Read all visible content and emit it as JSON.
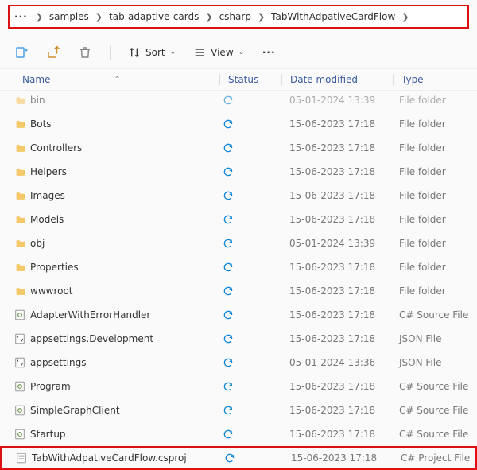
{
  "breadcrumb": {
    "items": [
      "samples",
      "tab-adaptive-cards",
      "csharp",
      "TabWithAdpativeCardFlow"
    ]
  },
  "toolbar": {
    "sort_label": "Sort",
    "view_label": "View"
  },
  "columns": {
    "name": "Name",
    "status": "Status",
    "date": "Date modified",
    "type": "Type"
  },
  "rows": [
    {
      "name": "bin",
      "icon": "folder",
      "date": "05-01-2024 13:39",
      "type": "File folder",
      "faded": true
    },
    {
      "name": "Bots",
      "icon": "folder",
      "date": "15-06-2023 17:18",
      "type": "File folder"
    },
    {
      "name": "Controllers",
      "icon": "folder",
      "date": "15-06-2023 17:18",
      "type": "File folder"
    },
    {
      "name": "Helpers",
      "icon": "folder",
      "date": "15-06-2023 17:18",
      "type": "File folder"
    },
    {
      "name": "Images",
      "icon": "folder",
      "date": "15-06-2023 17:18",
      "type": "File folder"
    },
    {
      "name": "Models",
      "icon": "folder",
      "date": "15-06-2023 17:18",
      "type": "File folder"
    },
    {
      "name": "obj",
      "icon": "folder",
      "date": "05-01-2024 13:39",
      "type": "File folder"
    },
    {
      "name": "Properties",
      "icon": "folder",
      "date": "15-06-2023 17:18",
      "type": "File folder"
    },
    {
      "name": "wwwroot",
      "icon": "folder",
      "date": "15-06-2023 17:18",
      "type": "File folder"
    },
    {
      "name": "AdapterWithErrorHandler",
      "icon": "cs",
      "date": "15-06-2023 17:18",
      "type": "C# Source File"
    },
    {
      "name": "appsettings.Development",
      "icon": "json",
      "date": "15-06-2023 17:18",
      "type": "JSON File"
    },
    {
      "name": "appsettings",
      "icon": "json",
      "date": "05-01-2024 13:36",
      "type": "JSON File"
    },
    {
      "name": "Program",
      "icon": "cs",
      "date": "15-06-2023 17:18",
      "type": "C# Source File"
    },
    {
      "name": "SimpleGraphClient",
      "icon": "cs",
      "date": "15-06-2023 17:18",
      "type": "C# Source File"
    },
    {
      "name": "Startup",
      "icon": "cs",
      "date": "15-06-2023 17:18",
      "type": "C# Source File"
    },
    {
      "name": "TabWithAdpativeCardFlow.csproj",
      "icon": "proj",
      "date": "15-06-2023 17:18",
      "type": "C# Project File",
      "highlight": true
    }
  ]
}
